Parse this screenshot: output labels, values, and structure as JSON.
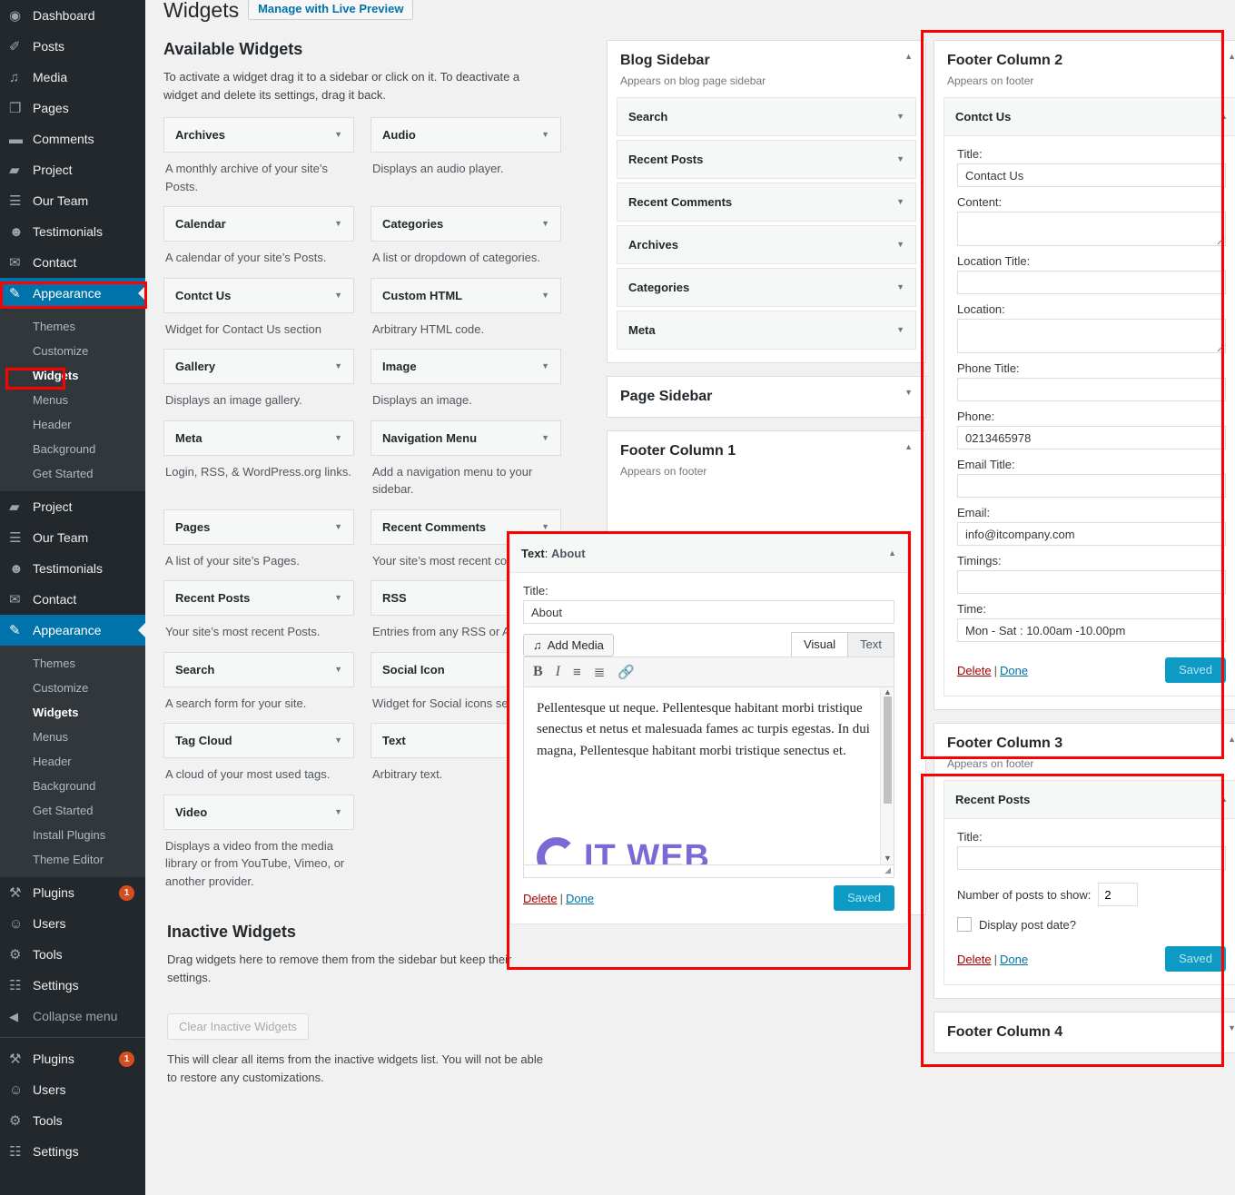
{
  "sidebar": {
    "top_items": [
      {
        "icon": "dashboard-icon",
        "glyph": "◉",
        "label": "Dashboard"
      },
      {
        "icon": "posts-pin-icon",
        "glyph": "✐",
        "label": "Posts"
      },
      {
        "icon": "media-icon",
        "glyph": "♫",
        "label": "Media"
      },
      {
        "icon": "pages-icon",
        "glyph": "❐",
        "label": "Pages"
      },
      {
        "icon": "comments-icon",
        "glyph": "▬",
        "label": "Comments"
      },
      {
        "icon": "project-folder-icon",
        "glyph": "▰",
        "label": "Project"
      },
      {
        "icon": "our-team-icon",
        "glyph": "☰",
        "label": "Our Team"
      },
      {
        "icon": "testimonials-icon",
        "glyph": "☻",
        "label": "Testimonials"
      },
      {
        "icon": "contact-envelope-icon",
        "glyph": "✉",
        "label": "Contact"
      }
    ],
    "appearance_label": "Appearance",
    "appearance_icon": "appearance-brush-icon",
    "appearance_submenu_1": [
      "Themes",
      "Customize",
      "Widgets",
      "Menus",
      "Header",
      "Background",
      "Get Started"
    ],
    "mid_items": [
      {
        "icon": "project-folder-icon",
        "glyph": "▰",
        "label": "Project"
      },
      {
        "icon": "our-team-icon",
        "glyph": "☰",
        "label": "Our Team"
      },
      {
        "icon": "testimonials-icon",
        "glyph": "☻",
        "label": "Testimonials"
      },
      {
        "icon": "contact-envelope-icon",
        "glyph": "✉",
        "label": "Contact"
      }
    ],
    "appearance_submenu_2": [
      "Themes",
      "Customize",
      "Widgets",
      "Menus",
      "Header",
      "Background",
      "Get Started",
      "Install Plugins",
      "Theme Editor"
    ],
    "current_submenu_item": "Widgets",
    "bottom_items_1": [
      {
        "icon": "plugins-icon",
        "glyph": "⚒",
        "label": "Plugins",
        "badge": "1"
      },
      {
        "icon": "users-icon",
        "glyph": "☺",
        "label": "Users",
        "badge": ""
      },
      {
        "icon": "tools-icon",
        "glyph": "⚙",
        "label": "Tools",
        "badge": ""
      },
      {
        "icon": "settings-icon",
        "glyph": "☷",
        "label": "Settings",
        "badge": ""
      }
    ],
    "collapse_label": "Collapse menu",
    "collapse_icon": "collapse-arrow-icon",
    "bottom_items_2": [
      {
        "icon": "plugins-icon",
        "glyph": "⚒",
        "label": "Plugins",
        "badge": "1"
      },
      {
        "icon": "users-icon",
        "glyph": "☺",
        "label": "Users",
        "badge": ""
      },
      {
        "icon": "tools-icon",
        "glyph": "⚙",
        "label": "Tools",
        "badge": ""
      },
      {
        "icon": "settings-icon",
        "glyph": "☷",
        "label": "Settings",
        "badge": ""
      }
    ]
  },
  "header": {
    "title": "Widgets",
    "live_preview_button": "Manage with Live Preview"
  },
  "available": {
    "title": "Available Widgets",
    "description": "To activate a widget drag it to a sidebar or click on it. To deactivate a widget and delete its settings, drag it back.",
    "widgets": [
      {
        "name": "Archives",
        "desc": "A monthly archive of your site’s Posts."
      },
      {
        "name": "Audio",
        "desc": "Displays an audio player."
      },
      {
        "name": "Calendar",
        "desc": "A calendar of your site’s Posts."
      },
      {
        "name": "Categories",
        "desc": "A list or dropdown of categories."
      },
      {
        "name": "Contct Us",
        "desc": "Widget for Contact Us section"
      },
      {
        "name": "Custom HTML",
        "desc": "Arbitrary HTML code."
      },
      {
        "name": "Gallery",
        "desc": "Displays an image gallery."
      },
      {
        "name": "Image",
        "desc": "Displays an image."
      },
      {
        "name": "Meta",
        "desc": "Login, RSS, & WordPress.org links."
      },
      {
        "name": "Navigation Menu",
        "desc": "Add a navigation menu to your sidebar."
      },
      {
        "name": "Pages",
        "desc": "A list of your site’s Pages."
      },
      {
        "name": "Recent Comments",
        "desc": "Your site’s most recent comments."
      },
      {
        "name": "Recent Posts",
        "desc": "Your site’s most recent Posts."
      },
      {
        "name": "RSS",
        "desc": "Entries from any RSS or Atom feed."
      },
      {
        "name": "Search",
        "desc": "A search form for your site."
      },
      {
        "name": "Social Icon",
        "desc": "Widget for Social icons section"
      },
      {
        "name": "Tag Cloud",
        "desc": "A cloud of your most used tags."
      },
      {
        "name": "Text",
        "desc": "Arbitrary text."
      },
      {
        "name": "Video",
        "desc": "Displays a video from the media library or from YouTube, Vimeo, or another provider."
      }
    ]
  },
  "inactive": {
    "title": "Inactive Widgets",
    "description": "Drag widgets here to remove them from the sidebar but keep their settings.",
    "clear_button": "Clear Inactive Widgets",
    "note": "This will clear all items from the inactive widgets list. You will not be able to restore any customizations."
  },
  "blog_sidebar": {
    "title": "Blog Sidebar",
    "subtitle": "Appears on blog page sidebar",
    "widgets": [
      "Search",
      "Recent Posts",
      "Recent Comments",
      "Archives",
      "Categories",
      "Meta"
    ]
  },
  "page_sidebar": {
    "title": "Page Sidebar"
  },
  "footer_column_1": {
    "title": "Footer Column 1",
    "subtitle": "Appears on footer"
  },
  "text_widget": {
    "type_label": "Text",
    "separator": ": ",
    "name": "About",
    "title_label": "Title:",
    "title_value": "About",
    "add_media_button": "Add Media",
    "add_media_icon": "add-media-icon",
    "tab_visual": "Visual",
    "tab_text": "Text",
    "toolbar": {
      "bold": "B",
      "italic": "I",
      "bullet_list_icon": "unordered-list-icon",
      "numbered_list_icon": "ordered-list-icon",
      "link_icon": "link-icon"
    },
    "body": "Pellentesque ut neque. Pellentesque habitant morbi tristique senectus et netus et malesuada fames ac turpis egestas. In dui magna, Pellentesque habitant morbi tristique senectus et.",
    "logo_text": "IT WEB",
    "delete_label": "Delete",
    "done_label": "Done",
    "saved_button": "Saved"
  },
  "footer_column_2": {
    "title": "Footer Column 2",
    "subtitle": "Appears on footer",
    "widget_name": "Contct Us",
    "fields": [
      {
        "label": "Title:",
        "value": "Contact Us",
        "type": "text"
      },
      {
        "label": "Content:",
        "value": "",
        "type": "textarea"
      },
      {
        "label": "Location Title:",
        "value": "",
        "type": "text"
      },
      {
        "label": "Location:",
        "value": "",
        "type": "textarea"
      },
      {
        "label": "Phone Title:",
        "value": "",
        "type": "text"
      },
      {
        "label": "Phone:",
        "value": "0213465978",
        "type": "text"
      },
      {
        "label": "Email Title:",
        "value": "",
        "type": "text"
      },
      {
        "label": "Email:",
        "value": "info@itcompany.com",
        "type": "text"
      },
      {
        "label": "Timings:",
        "value": "",
        "type": "text"
      },
      {
        "label": "Time:",
        "value": "Mon - Sat : 10.00am -10.00pm",
        "type": "text"
      }
    ],
    "delete_label": "Delete",
    "done_label": "Done",
    "saved_button": "Saved"
  },
  "footer_column_3": {
    "title": "Footer Column 3",
    "subtitle": "Appears on footer",
    "widget_name": "Recent Posts",
    "title_label": "Title:",
    "title_value": "",
    "number_label": "Number of posts to show:",
    "number_value": "2",
    "display_date_label": "Display post date?",
    "display_date_checked": false,
    "delete_label": "Delete",
    "done_label": "Done",
    "saved_button": "Saved"
  },
  "footer_column_4": {
    "title": "Footer Column 4"
  },
  "colors": {
    "accent": "#0073aa",
    "saved_button": "#0d9bc5",
    "highlight": "#ff0000",
    "admin_bg": "#23282d",
    "submenu_bg": "#32373c",
    "delete_link": "#a00000",
    "logo_purple": "#7c6ad4"
  }
}
